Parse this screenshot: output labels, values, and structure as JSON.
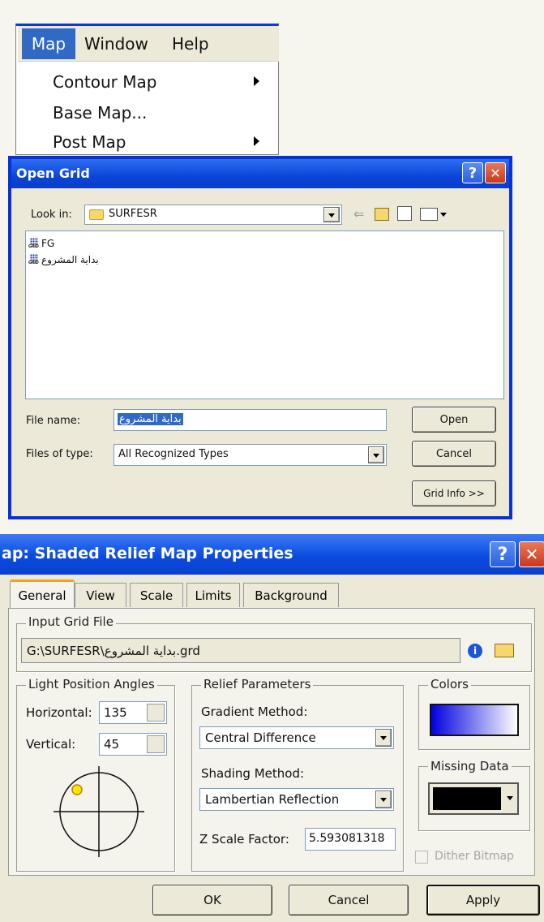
{
  "menu": {
    "bar": {
      "map": "Map",
      "window": "Window",
      "help": "Help"
    },
    "items": [
      {
        "label": "Contour Map",
        "has_submenu": true
      },
      {
        "label": "Base Map...",
        "has_submenu": false
      },
      {
        "label": "Post Map",
        "has_submenu": true
      }
    ]
  },
  "open_grid": {
    "title": "Open Grid",
    "help_glyph": "?",
    "close_glyph": "✕",
    "look_in_label": "Look in:",
    "look_in_value": "SURFESR",
    "files": [
      {
        "name": "FG"
      },
      {
        "name": "بداية المشروع"
      }
    ],
    "file_name_label": "File name:",
    "file_name_value": "بداية المشروع",
    "files_of_type_label": "Files of type:",
    "files_of_type_value": "All Recognized Types",
    "open_button": "Open",
    "cancel_button": "Cancel",
    "grid_info_button": "Grid Info >>"
  },
  "props": {
    "title": "ap: Shaded Relief Map Properties",
    "help_glyph": "?",
    "close_glyph": "✕",
    "tabs": [
      "General",
      "View",
      "Scale",
      "Limits",
      "Background"
    ],
    "active_tab": "General",
    "input_grid_label": "Input Grid File",
    "input_grid_value": "G:\\SURFESR\\بداية المشروع.grd",
    "light_group": "Light Position Angles",
    "horizontal_label": "Horizontal:",
    "horizontal_value": "135",
    "vertical_label": "Vertical:",
    "vertical_value": "45",
    "relief_group": "Relief Parameters",
    "gradient_label": "Gradient Method:",
    "gradient_value": "Central Difference",
    "shading_label": "Shading Method:",
    "shading_value": "Lambertian Reflection",
    "zscale_label": "Z Scale Factor:",
    "zscale_value": "5.593081318",
    "colors_group": "Colors",
    "missing_group": "Missing Data",
    "dither_label": "Dither Bitmap",
    "ok_button": "OK",
    "cancel_button": "Cancel",
    "apply_button": "Apply"
  }
}
